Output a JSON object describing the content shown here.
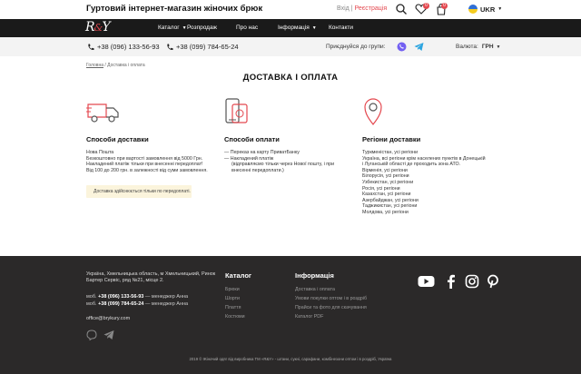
{
  "topbar": {
    "site_title": "Гуртовий інтернет-магазин жіночих брюк",
    "login": "Вхід",
    "separator": "|",
    "register": "Реєстрація",
    "favorites_count": "0",
    "cart_count": "0",
    "language": "UKR"
  },
  "nav": {
    "logo": "R&Y",
    "items": [
      "Каталог",
      "Розпродаж",
      "Про нас",
      "Інформація",
      "Контакти"
    ]
  },
  "contacts": {
    "phone1": "+38 (096) 133-56-93",
    "phone2": "+38 (099) 784-65-24",
    "join_label": "Приєднуйся до групи:",
    "currency_label": "Валюта:",
    "currency_value": "ГРН"
  },
  "breadcrumb": {
    "home": "Головна",
    "sep": "/",
    "current": "Доставка і оплата"
  },
  "page_title": "ДОСТАВКА І ОПЛАТА",
  "delivery": {
    "title": "Способи доставки",
    "items": [
      "Нова Пошта",
      "Безкоштовно при вартості замовлення від 5000 Грн.",
      "Накладений платіж тільки при внесенні передоплат!",
      "Від 100 до 200 грн. в залежності від суми замовлення."
    ],
    "note": "Доставка здійснюється тільки по передоплаті."
  },
  "payment": {
    "title": "Способи оплати",
    "items": [
      "— Переказ на карту ПриватБанку",
      "— Накладений платіж",
      "(відправляємо тільки через Нової пошту, і при",
      "внесенні передоплати.)"
    ]
  },
  "regions": {
    "title": "Регіони доставки",
    "items": [
      "Туркменістан, усі регіони",
      "Україна, всі регіони крім населених пунктів в Донецькій",
      "і Луганській області де проходить зона АТО.",
      "Вірменія, усі регіони",
      "Білорусія, усі регіони",
      "Узбекистан, усі регіони",
      "Росія, усі регіони",
      "Казахстан, усі регіони",
      "Азербайджан, усі регіони",
      "Таджикистан, усі регіони",
      "Молдова, усі регіони"
    ]
  },
  "footer": {
    "address": "Україна, Хмельницька область, м Хмельницький, Ринок Бартер Сервіс, ряд №21, місце 2.",
    "phone1_prefix": "моб.",
    "phone1": "+38 (096) 133-56-93",
    "phone1_suffix": "— менеджер Анна",
    "phone2_prefix": "моб.",
    "phone2": "+38 (099) 784-65-24",
    "phone2_suffix": "— менеджер Анна",
    "email": "office@brykury.com",
    "catalog_title": "Каталог",
    "catalog_items": [
      "Брюки",
      "Шорти",
      "Плаття",
      "Костюми"
    ],
    "info_title": "Інформація",
    "info_items": [
      "Доставка і оплата",
      "Умови покупки оптом і в роздріб",
      "Прайси та фото для скачування",
      "Каталог PDF"
    ],
    "copyright": "2019 © Жіночий одяг від виробника ТМ «R&Y» - штани, сукні, сарафани, комбінезони оптом і в роздріб, Україна"
  },
  "colors": {
    "accent": "#e4484f",
    "nav_bg": "#1a1a1a",
    "footer_bg": "#2b2929"
  }
}
